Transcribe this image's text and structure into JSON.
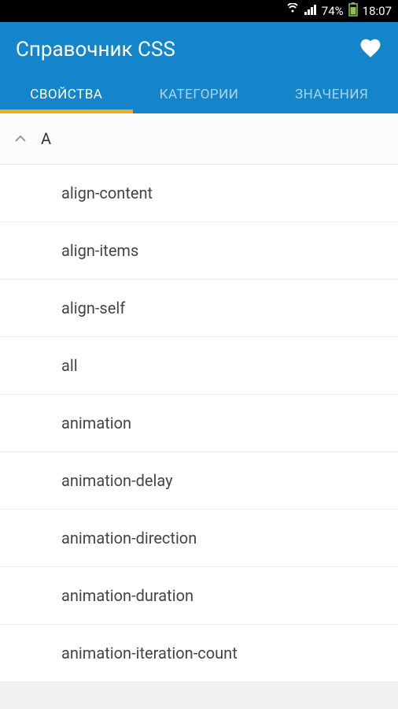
{
  "status": {
    "battery": "74%",
    "time": "18:07"
  },
  "header": {
    "title": "Справочник CSS"
  },
  "tabs": [
    {
      "label": "СВОЙСТВА",
      "active": true
    },
    {
      "label": "КАТЕГОРИИ",
      "active": false
    },
    {
      "label": "ЗНАЧЕНИЯ",
      "active": false
    }
  ],
  "section": {
    "letter": "A"
  },
  "items": [
    "align-content",
    "align-items",
    "align-self",
    "all",
    "animation",
    "animation-delay",
    "animation-direction",
    "animation-duration",
    "animation-iteration-count"
  ]
}
